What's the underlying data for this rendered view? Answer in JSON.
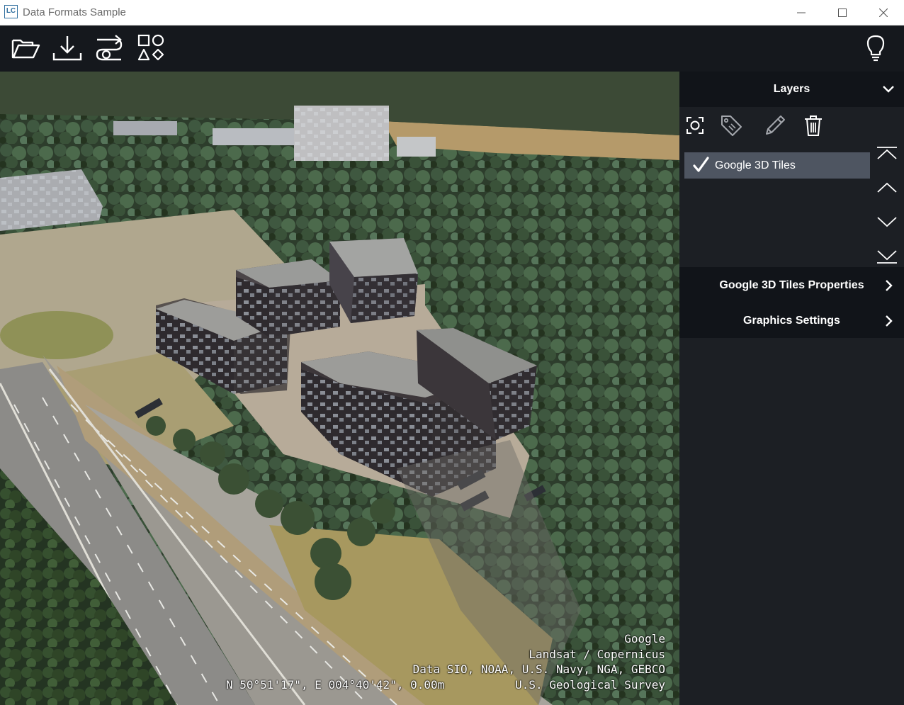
{
  "window": {
    "title": "Data Formats Sample",
    "logo_text": "LC"
  },
  "toolbar": {
    "buttons": [
      "folder-open-icon",
      "download-icon",
      "route-icon",
      "shapes-icon"
    ],
    "right_button": "lightbulb-icon"
  },
  "map": {
    "attribution": [
      "Google",
      "Landsat / Copernicus",
      "Data SIO, NOAA, U.S. Navy, NGA, GEBCO",
      "U.S. Geological Survey"
    ],
    "coordinates": "N 50°51'17\", E 004°40'42\", 0.00m"
  },
  "layers_panel": {
    "title": "Layers",
    "tools": [
      "fit-icon",
      "label-icon",
      "edit-icon",
      "delete-icon"
    ],
    "layers": [
      {
        "name": "Google 3D Tiles",
        "visible": true
      }
    ],
    "order_buttons": [
      "move-to-top-icon",
      "move-up-icon",
      "move-down-icon",
      "move-to-bottom-icon"
    ],
    "sections": [
      {
        "label": "Google 3D Tiles Properties"
      },
      {
        "label": "Graphics Settings"
      }
    ]
  },
  "colors": {
    "toolbar_bg": "#15181d",
    "panel_bg": "#1c1f24",
    "header_bg": "#111419",
    "selected_row": "#4e5561"
  }
}
